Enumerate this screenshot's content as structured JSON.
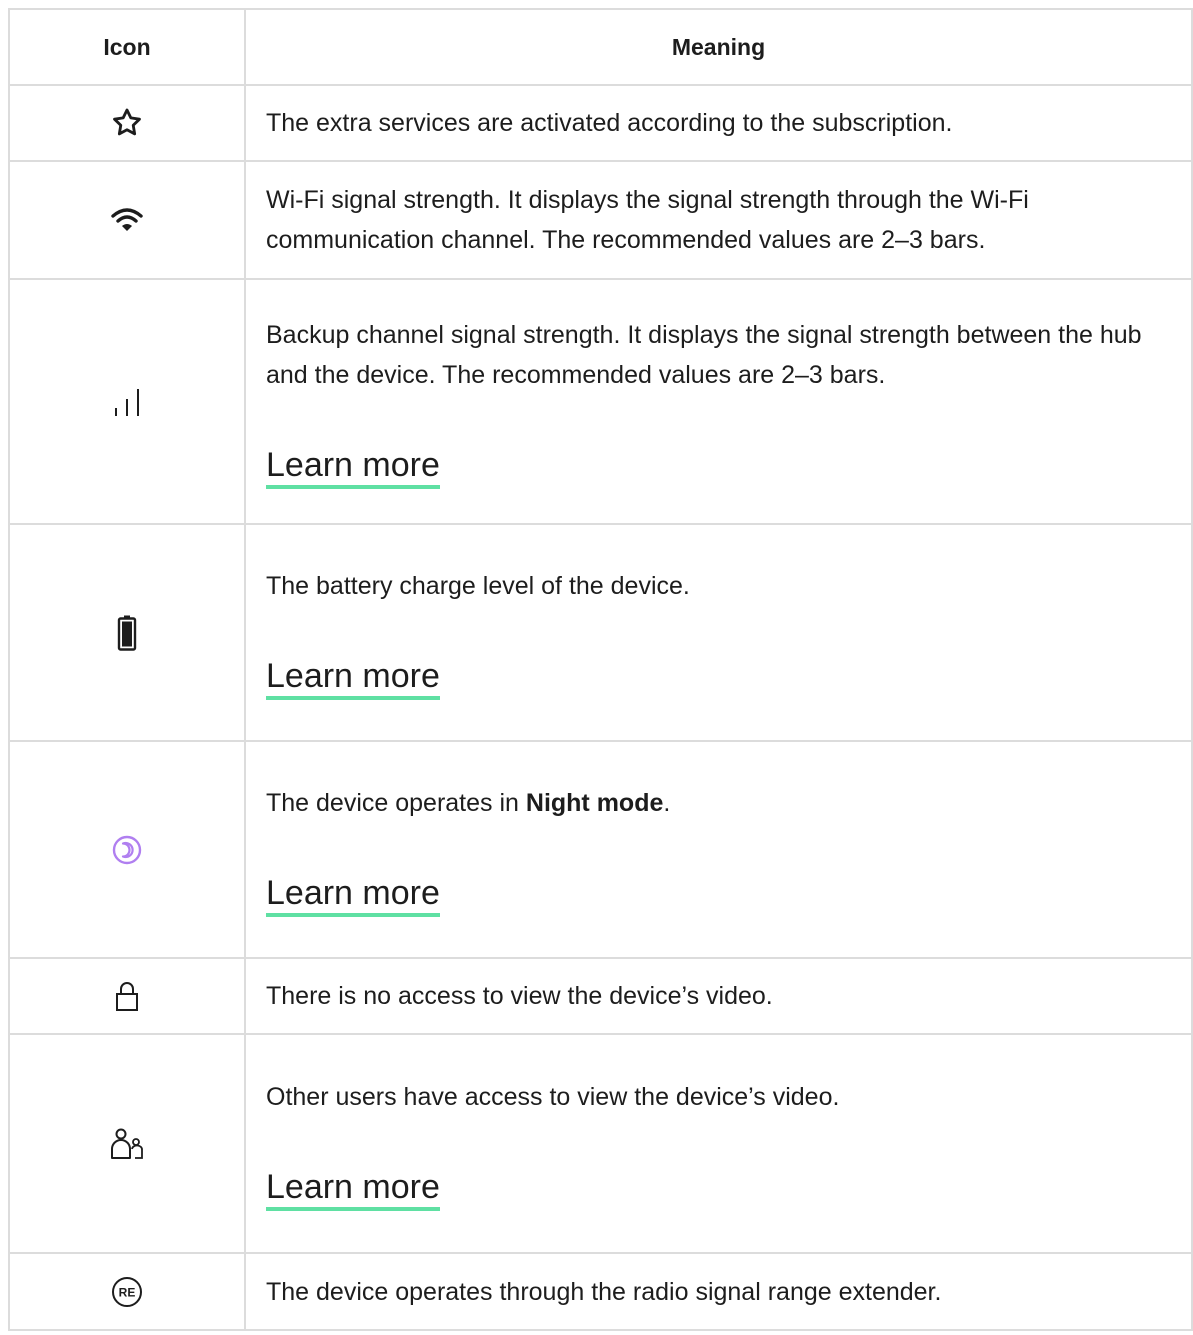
{
  "header": {
    "icon_col": "Icon",
    "meaning_col": "Meaning"
  },
  "rows": [
    {
      "icon": "star-outline-icon",
      "text": "The extra services are activated according to the subscription."
    },
    {
      "icon": "wifi-icon",
      "text": "Wi-Fi signal strength. It displays the signal strength through the Wi-Fi communication channel. The recommended values are 2–3 bars."
    },
    {
      "icon": "signal-bars-icon",
      "text": "Backup channel signal strength. It displays the signal strength between the hub and the device. The recommended values are 2–3 bars.",
      "link": "Learn more"
    },
    {
      "icon": "battery-icon",
      "text": "The battery charge level of the device.",
      "link": "Learn more"
    },
    {
      "icon": "night-mode-icon",
      "text_before": "The device operates in ",
      "text_bold": "Night mode",
      "text_after": ".",
      "link": "Learn more"
    },
    {
      "icon": "lock-icon",
      "text": "There is no access to view the device’s video."
    },
    {
      "icon": "shared-users-icon",
      "text": "Other users have access to view the device’s video.",
      "link": "Learn more"
    },
    {
      "icon": "range-extender-icon",
      "icon_text": "RE",
      "text": "The device operates through the radio signal range extender."
    }
  ],
  "colors": {
    "link_underline": "#5fe0a3",
    "night_mode_icon": "#b07ff0",
    "border": "#dcdcdc",
    "text": "#1d1d1d"
  }
}
